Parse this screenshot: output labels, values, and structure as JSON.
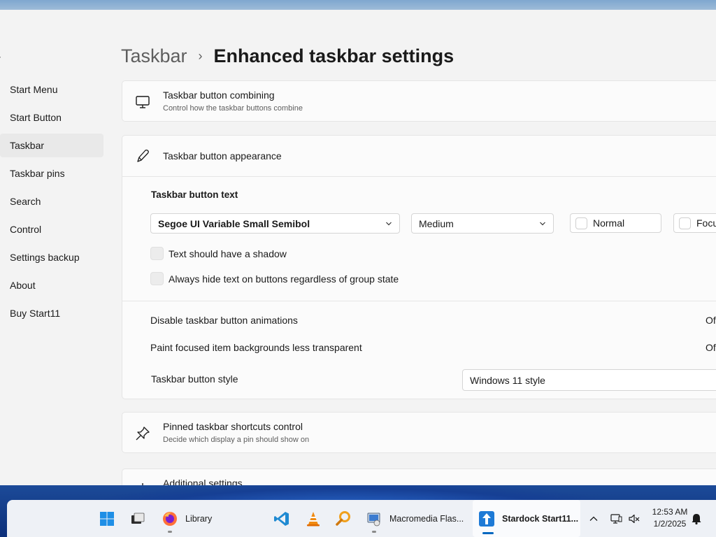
{
  "colors": {
    "accent": "#0067c0",
    "window_bg": "#f3f3f3",
    "card_bg": "#fbfbfb",
    "wallpaper": "#1d4c9a"
  },
  "sidebar": {
    "items": [
      {
        "label": "Start Menu"
      },
      {
        "label": "Start Button"
      },
      {
        "label": "Taskbar",
        "active": true
      },
      {
        "label": "Taskbar pins"
      },
      {
        "label": "Search"
      },
      {
        "label": "Control"
      },
      {
        "label": "Settings backup"
      },
      {
        "label": "About"
      },
      {
        "label": "Buy Start11"
      }
    ]
  },
  "breadcrumb": {
    "parent": "Taskbar",
    "separator": "›",
    "current": "Enhanced taskbar settings"
  },
  "cards": {
    "combining": {
      "icon": "monitor-icon",
      "title": "Taskbar button combining",
      "subtitle": "Control how the taskbar buttons combine"
    },
    "appearance": {
      "icon": "pen-icon",
      "title": "Taskbar button appearance",
      "text_section_label": "Taskbar button text",
      "font_dropdown": "Segoe UI Variable Small Semibol",
      "size_dropdown": "Medium",
      "normal_chip": "Normal",
      "focus_chip": "Focu",
      "checkbox_shadow": "Text should have a shadow",
      "checkbox_hide": "Always hide text on buttons regardless of group state",
      "disable_animations_label": "Disable taskbar button animations",
      "disable_animations_value": "Of",
      "paint_focused_label": "Paint focused item backgrounds less transparent",
      "paint_focused_value": "Of",
      "button_style_label": "Taskbar button style",
      "button_style_value": "Windows 11 style"
    },
    "pinned": {
      "icon": "pin-icon",
      "title": "Pinned taskbar shortcuts control",
      "subtitle": "Decide which display a pin should show on"
    },
    "additional": {
      "icon": "plus-icon",
      "title": "Additional settings"
    }
  },
  "taskbar": {
    "apps": [
      {
        "name": "start-button",
        "icon": "windows-logo-icon"
      },
      {
        "name": "file-explorer",
        "icon": "folder-icon"
      },
      {
        "name": "firefox",
        "icon": "firefox-icon",
        "label": "Library"
      },
      {
        "name": "vscode",
        "icon": "vscode-icon"
      },
      {
        "name": "vlc",
        "icon": "vlc-cone-icon"
      },
      {
        "name": "search-tool",
        "icon": "magnifier-icon"
      },
      {
        "name": "macromedia-flash",
        "icon": "flash-installer-icon",
        "label": "Macromedia Flas..."
      },
      {
        "name": "stardock-start11",
        "icon": "start11-icon",
        "label": "Stardock Start11..."
      }
    ],
    "tray": {
      "overflow_icon": "chevron-up-icon",
      "network_icon": "network-icon",
      "volume_icon": "volume-muted-icon",
      "notification_icon": "bell-icon"
    },
    "clock": {
      "time": "12:53 AM",
      "date": "1/2/2025"
    }
  }
}
